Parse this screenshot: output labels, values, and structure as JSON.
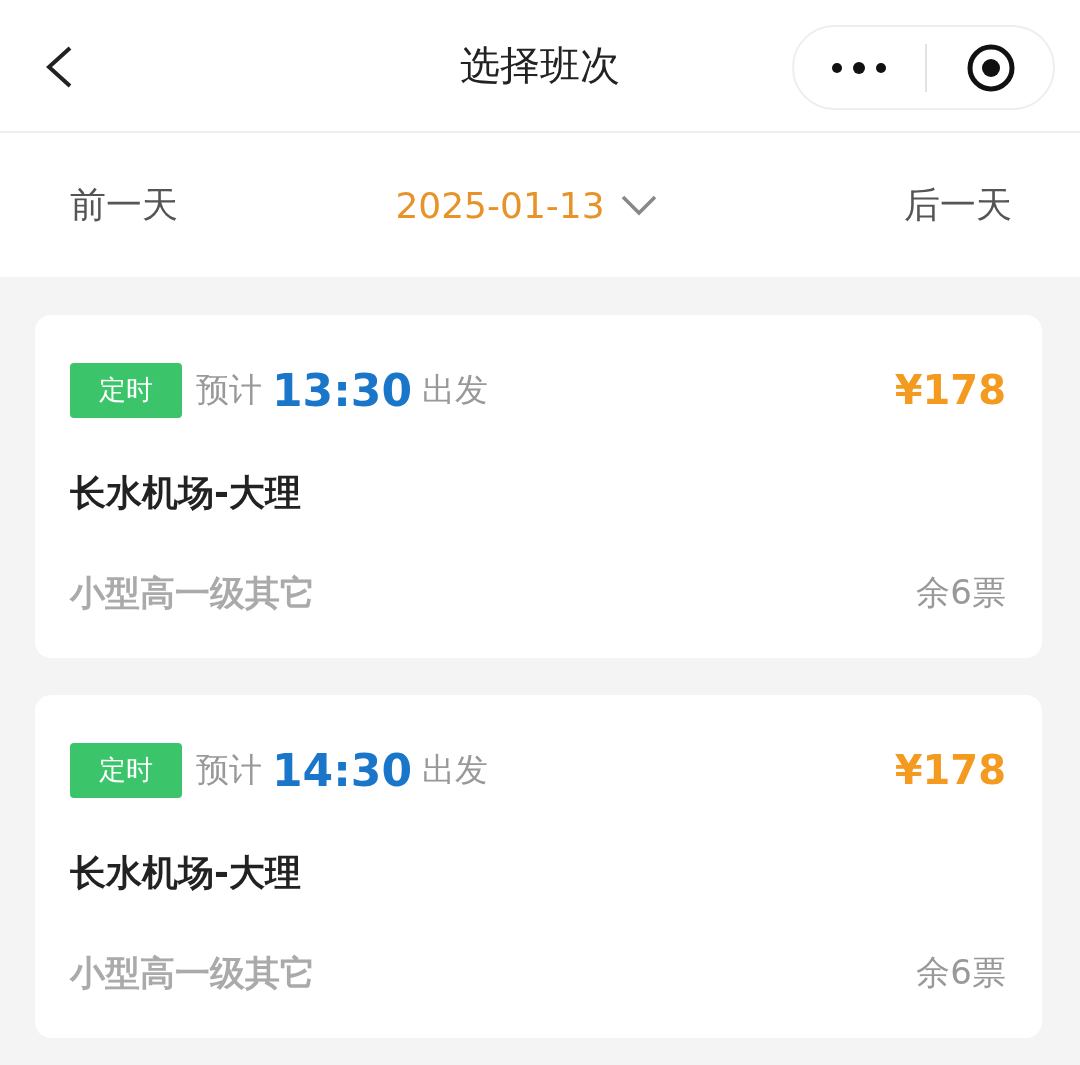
{
  "window": {
    "title": "选择班次"
  },
  "date_nav": {
    "prev": "前一天",
    "date": "2025-01-13",
    "next": "后一天"
  },
  "trips": [
    {
      "tag": "定时",
      "prefix": "预计",
      "time": "13:30",
      "suffix": "出发",
      "price": "¥178",
      "route": "长水机场-大理",
      "vehicle": "小型高一级其它",
      "remaining": "余6票"
    },
    {
      "tag": "定时",
      "prefix": "预计",
      "time": "14:30",
      "suffix": "出发",
      "price": "¥178",
      "route": "长水机场-大理",
      "vehicle": "小型高一级其它",
      "remaining": "余6票"
    }
  ]
}
